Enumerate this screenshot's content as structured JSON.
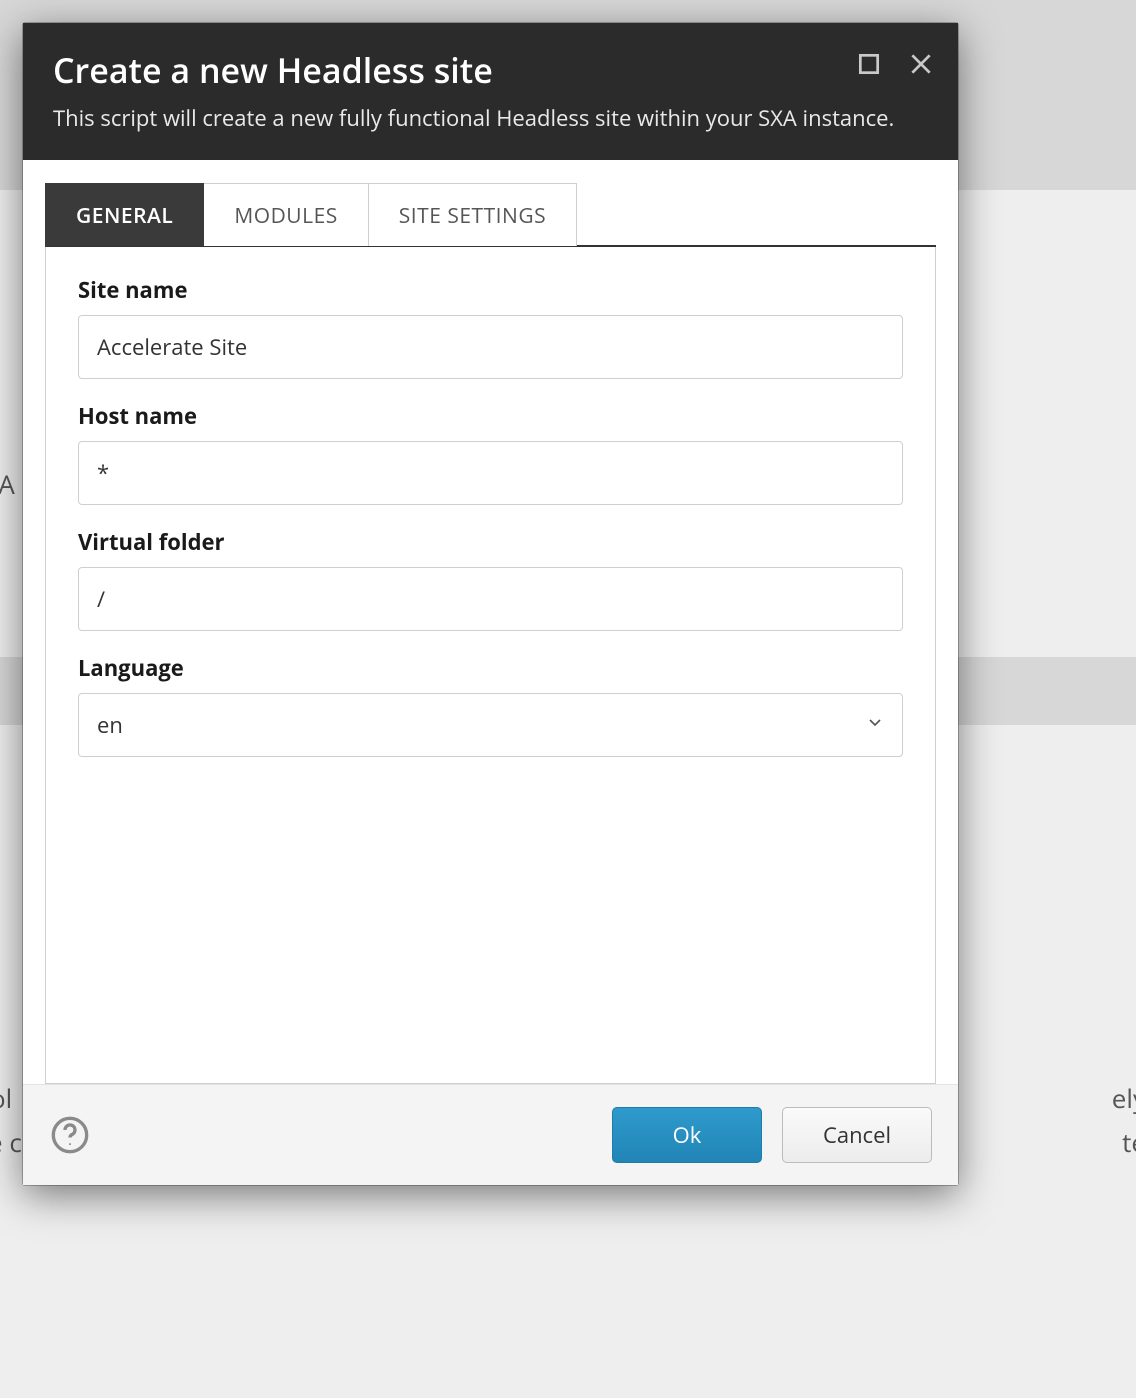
{
  "bg": {
    "l1": "-A",
    "l2": "ol",
    "l3": "e c",
    "r1": "ely",
    "r2": "te"
  },
  "header": {
    "title": "Create a new Headless site",
    "subtitle": "This script will create a new fully functional Headless site within your SXA instance."
  },
  "tabs": [
    {
      "label": "GENERAL",
      "active": true
    },
    {
      "label": "MODULES",
      "active": false
    },
    {
      "label": "SITE SETTINGS",
      "active": false
    }
  ],
  "form": {
    "siteName": {
      "label": "Site name",
      "value": "Accelerate Site"
    },
    "hostName": {
      "label": "Host name",
      "value": "*"
    },
    "virtualFolder": {
      "label": "Virtual folder",
      "value": "/"
    },
    "language": {
      "label": "Language",
      "value": "en"
    }
  },
  "footer": {
    "ok": "Ok",
    "cancel": "Cancel"
  }
}
